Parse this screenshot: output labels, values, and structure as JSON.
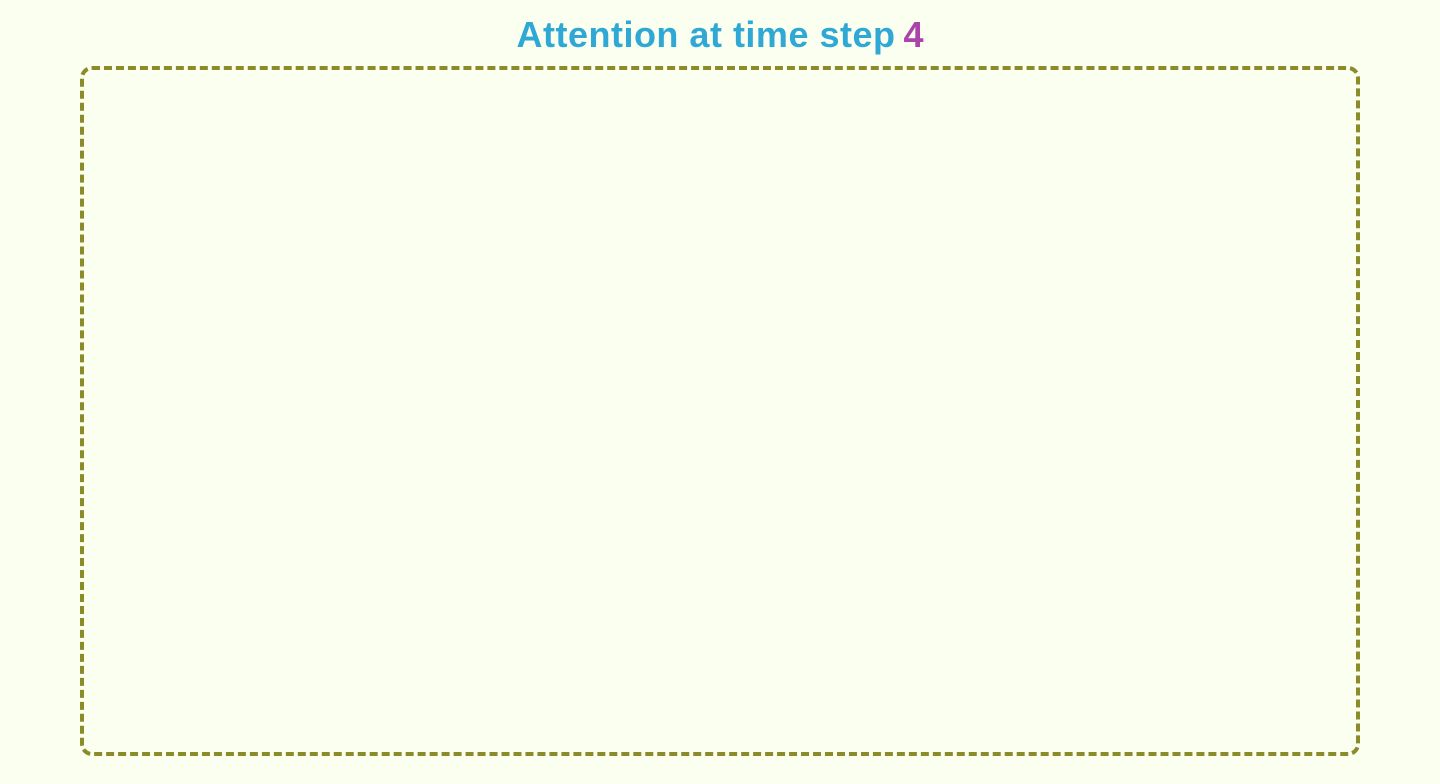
{
  "title": {
    "text": "Attention at time step",
    "number": "4",
    "text_color": "#2fa8d5",
    "number_color": "#aa44aa"
  },
  "box": {
    "border_color": "#8b8b2a",
    "background_color": "#fafff0"
  }
}
